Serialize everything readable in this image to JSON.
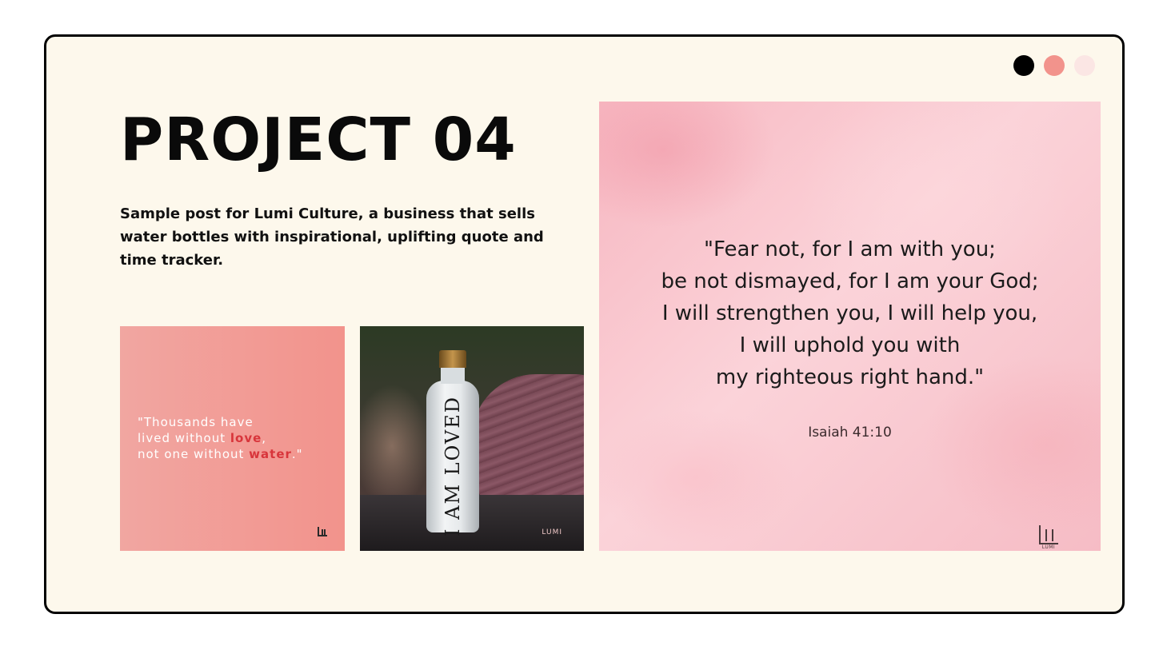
{
  "slide": {
    "title": "PROJECT 04",
    "description": "Sample post for Lumi Culture, a business that sells water bottles with inspirational, uplifting quote and time tracker."
  },
  "window_dots": [
    {
      "color": "#000000"
    },
    {
      "color": "#f2938c"
    },
    {
      "color": "#fbe6e4"
    }
  ],
  "quote_post": {
    "line1": "\"Thousands have",
    "line2_prefix": "lived without ",
    "line2_highlight": "love",
    "line2_suffix": ",",
    "line3_prefix": "not one without ",
    "line3_highlight": "water",
    "line3_suffix": ".\"",
    "background_color": "#f2938c",
    "highlight_color": "#d8353b",
    "logo_icon": "lumi-logo-icon"
  },
  "bottle_post": {
    "bottle_text": "I AM LOVED",
    "brand": "LUMI"
  },
  "verse_post": {
    "lines": [
      "\"Fear not, for I am with you;",
      "be not dismayed, for I am your God;",
      "I will strengthen you, I will help you,",
      "I will uphold you with",
      "my righteous right hand.\""
    ],
    "reference": "Isaiah 41:10",
    "brand": "LUMI",
    "background_color": "#f7b7c1"
  }
}
